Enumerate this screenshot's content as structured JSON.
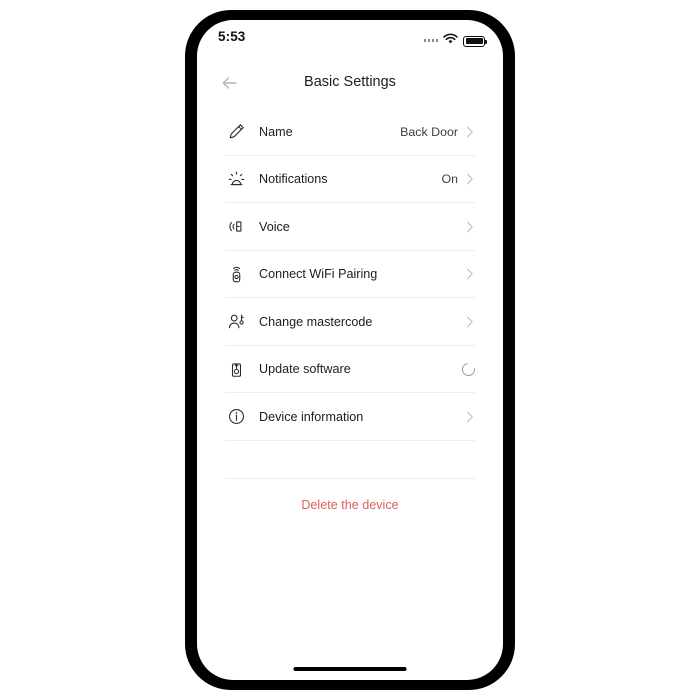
{
  "status_bar": {
    "time": "5:53",
    "signal_icon": "signal-dots-icon",
    "wifi_icon": "wifi-icon",
    "battery_icon": "battery-full-icon"
  },
  "nav": {
    "back_icon": "arrow-left-icon",
    "title": "Basic Settings"
  },
  "rows": [
    {
      "icon": "pencil-icon",
      "label": "Name",
      "value": "Back Door",
      "accessory": "chevron-right-icon"
    },
    {
      "icon": "alarm-siren-icon",
      "label": "Notifications",
      "value": "On",
      "accessory": "chevron-right-icon"
    },
    {
      "icon": "speaker-volume-icon",
      "label": "Voice",
      "value": "",
      "accessory": "chevron-right-icon"
    },
    {
      "icon": "wifi-remote-icon",
      "label": "Connect WiFi Pairing",
      "value": "",
      "accessory": "chevron-right-icon"
    },
    {
      "icon": "user-key-icon",
      "label": "Change mastercode",
      "value": "",
      "accessory": "chevron-right-icon"
    },
    {
      "icon": "software-update-icon",
      "label": "Update software",
      "value": "",
      "accessory": "loading-spinner-icon"
    },
    {
      "icon": "info-circle-icon",
      "label": "Device information",
      "value": "",
      "accessory": "chevron-right-icon"
    }
  ],
  "delete": {
    "label": "Delete the device"
  },
  "colors": {
    "danger": "#d9635f",
    "text_primary": "#1d1d1f",
    "divider": "#ededed",
    "chevron": "#c2c2c2"
  }
}
